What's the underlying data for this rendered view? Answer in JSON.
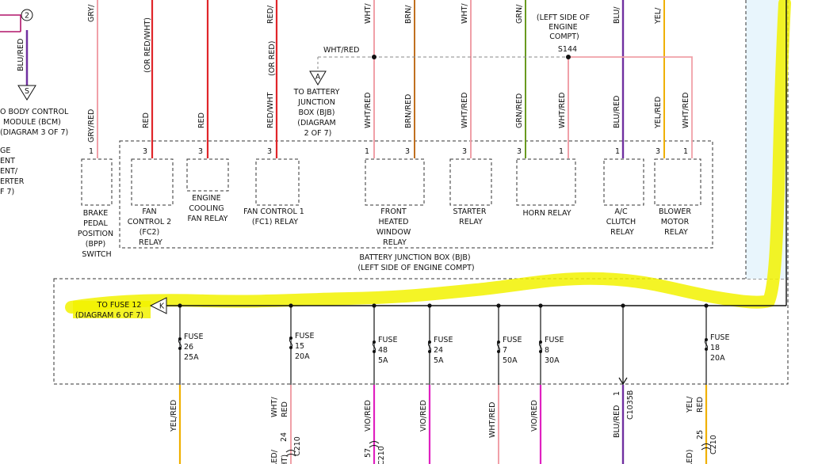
{
  "colors": {
    "panel_fill": "#e8f5fc",
    "highlight": "#f2f200",
    "wire_red": "#e0262a",
    "wire_pink": "#f0a0a8",
    "wire_gray": "#b0b0b0",
    "wire_orange": "#c07020",
    "wire_green": "#6a9a20",
    "wire_blue": "#7030a0",
    "wire_yellow": "#f0b000",
    "wire_violet": "#e020c0"
  },
  "top_left": {
    "circle_num": "2",
    "wire_label": "BLU/RED",
    "connector_letter": "S",
    "bcm_lines": [
      "O BODY CONTROL",
      "MODULE (BCM)",
      "(DIAGRAM 3 OF 7)"
    ],
    "left_cut_lines": [
      "GE",
      "ENT",
      "ENT/",
      "ERTER",
      "F 7)"
    ]
  },
  "top_wire_labels": {
    "gry": "GRY/",
    "or_red_wht": "(OR RED/WHT)",
    "red": "RED/",
    "or_red": "(OR RED)",
    "wht_top": "WHT/",
    "brn": "BRN/",
    "wht2": "WHT/",
    "grn": "GRN/",
    "blu": "BLU/",
    "yel": "YEL/"
  },
  "mid_wire_labels": {
    "gry_red": "GRY/RED",
    "red1": "RED",
    "red2": "RED",
    "red_wht": "RED/WHT",
    "or_red2": "(OR RED)",
    "wht_red1": "WHT/RED",
    "brn_red": "BRN/RED",
    "wht_red2": "WHT/RED",
    "grn_red": "GRN/RED",
    "wht_red3": "WHT/RED",
    "blu_red": "BLU/RED",
    "yel_red": "YEL/RED",
    "wht_red4": "WHT/RED"
  },
  "splice": {
    "wht_red": "WHT/RED",
    "left_side_lines": [
      "(LEFT SIDE OF",
      "ENGINE",
      "COMPT)"
    ],
    "s144": "S144",
    "conn_letter": "A",
    "bjb_lines": [
      "TO BATTERY",
      "JUNCTION",
      "BOX (BJB)",
      "(DIAGRAM",
      "2 OF 7)"
    ]
  },
  "pins": {
    "p1": "1",
    "p2": "3",
    "p3": "3",
    "p4": "3",
    "p5": "1",
    "p6": "3",
    "p7": "3",
    "p8": "3",
    "p9": "1",
    "p10": "1",
    "p11": "3",
    "p12": "1"
  },
  "components": {
    "bpp": [
      "BRAKE",
      "PEDAL",
      "POSITION",
      "(BPP)",
      "SWITCH"
    ],
    "fc2": [
      "FAN",
      "CONTROL 2",
      "(FC2)",
      "RELAY"
    ],
    "ecf": [
      "ENGINE",
      "COOLING",
      "FAN RELAY"
    ],
    "fc1": [
      "FAN CONTROL 1",
      "(FC1) RELAY"
    ],
    "fhw": [
      "FRONT",
      "HEATED",
      "WINDOW",
      "RELAY"
    ],
    "starter": [
      "STARTER",
      "RELAY"
    ],
    "horn": [
      "HORN RELAY"
    ],
    "ac": [
      "A/C",
      "CLUTCH",
      "RELAY"
    ],
    "blower": [
      "BLOWER",
      "MOTOR",
      "RELAY"
    ]
  },
  "bjb_caption": [
    "BATTERY JUNCTION BOX (BJB)",
    "(LEFT SIDE OF ENGINE COMPT)"
  ],
  "fuse_source": {
    "lines": [
      "TO FUSE 12",
      "(DIAGRAM 6 OF 7)"
    ],
    "letter": "K"
  },
  "fuses": [
    {
      "word": "FUSE",
      "num": "26",
      "amp": "25A"
    },
    {
      "word": "FUSE",
      "num": "15",
      "amp": "20A"
    },
    {
      "word": "FUSE",
      "num": "48",
      "amp": "5A"
    },
    {
      "word": "FUSE",
      "num": "24",
      "amp": "5A"
    },
    {
      "word": "FUSE",
      "num": "7",
      "amp": "50A"
    },
    {
      "word": "FUSE",
      "num": "8",
      "amp": "30A"
    },
    {
      "word": "FUSE",
      "num": "18",
      "amp": "20A"
    }
  ],
  "bottom_labels": {
    "b1": "YEL/RED",
    "b2a": "WHT/",
    "b2b": "RED",
    "b2c": "(OR RED/",
    "b2d": "WHT)",
    "b2pin": "24",
    "b2conn": "C210",
    "b3": "VIO/RED",
    "b3pin": "57",
    "b3conn": "C210",
    "b4": "VIO/RED",
    "b5": "WHT/RED",
    "b6": "VIO/RED",
    "b7": "BLU/RED",
    "b7pin": "1",
    "b7conn": "C1035B",
    "b8a": "YEL/",
    "b8b": "RED",
    "b8c": "(OR RED)",
    "b8pin": "25",
    "b8conn": "C210"
  }
}
